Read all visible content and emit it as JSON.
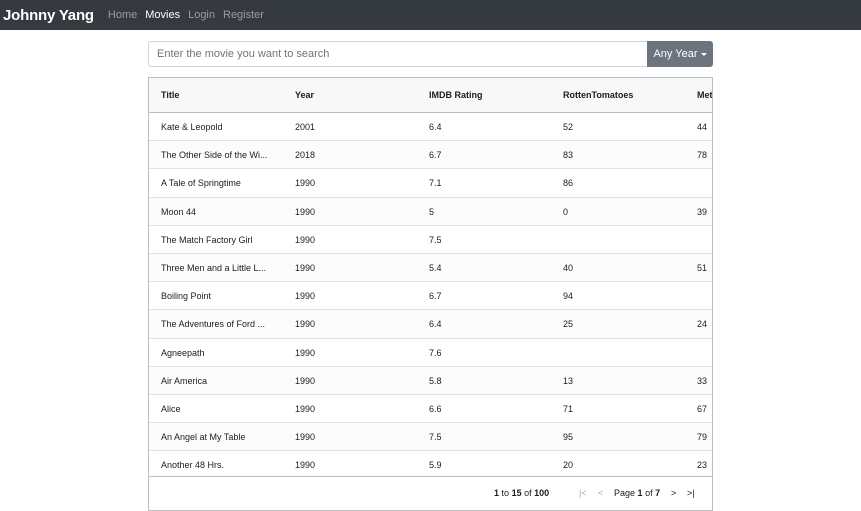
{
  "navbar": {
    "brand": "Johnny Yang",
    "links": [
      "Home",
      "Movies",
      "Login",
      "Register"
    ]
  },
  "search": {
    "placeholder": "Enter the movie you want to search",
    "value": "",
    "year_button": "Any Year"
  },
  "table": {
    "columns": [
      "Title",
      "Year",
      "IMDB Rating",
      "RottenTomatoes",
      "Met"
    ],
    "rows": [
      [
        "Kate & Leopold",
        "2001",
        "6.4",
        "52",
        "44"
      ],
      [
        "The Other Side of the Wi...",
        "2018",
        "6.7",
        "83",
        "78"
      ],
      [
        "A Tale of Springtime",
        "1990",
        "7.1",
        "86",
        ""
      ],
      [
        "Moon 44",
        "1990",
        "5",
        "0",
        "39"
      ],
      [
        "The Match Factory Girl",
        "1990",
        "7.5",
        "",
        ""
      ],
      [
        "Three Men and a Little L...",
        "1990",
        "5.4",
        "40",
        "51"
      ],
      [
        "Boiling Point",
        "1990",
        "6.7",
        "94",
        ""
      ],
      [
        "The Adventures of Ford ...",
        "1990",
        "6.4",
        "25",
        "24"
      ],
      [
        "Agneepath",
        "1990",
        "7.6",
        "",
        ""
      ],
      [
        "Air America",
        "1990",
        "5.8",
        "13",
        "33"
      ],
      [
        "Alice",
        "1990",
        "6.6",
        "71",
        "67"
      ],
      [
        "An Angel at My Table",
        "1990",
        "7.5",
        "95",
        "79"
      ],
      [
        "Another 48 Hrs.",
        "1990",
        "5.9",
        "20",
        "23"
      ]
    ]
  },
  "pagination": {
    "from": "1",
    "to_word": "to",
    "to": "15",
    "of_word": "of",
    "total": "100",
    "page_word": "Page",
    "page": "1",
    "page_of_word": "of",
    "pages": "7",
    "first_glyph": "|<",
    "prev_glyph": "<",
    "next_glyph": ">",
    "last_glyph": ">|"
  }
}
